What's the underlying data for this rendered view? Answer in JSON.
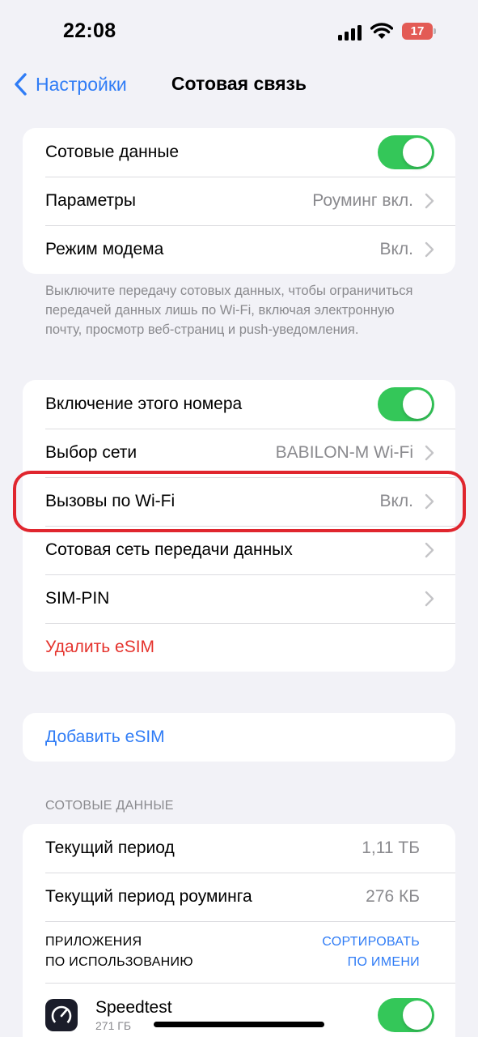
{
  "status_bar": {
    "time": "22:08",
    "battery_level": "17",
    "battery_color": "#e35b55"
  },
  "nav": {
    "back_label": "Настройки",
    "title": "Сотовая связь"
  },
  "group1": {
    "cellular_data_label": "Сотовые данные",
    "cellular_data_on": true,
    "options_label": "Параметры",
    "options_value": "Роуминг вкл.",
    "hotspot_label": "Режим модема",
    "hotspot_value": "Вкл."
  },
  "footnote": "Выключите передачу сотовых данных, чтобы ограничиться передачей данных лишь по Wi-Fi, включая электронную почту, просмотр веб-страниц и push-уведомления.",
  "group2": {
    "line_on_label": "Включение этого номера",
    "line_on": true,
    "network_label": "Выбор сети",
    "network_value": "BABILON-M Wi-Fi",
    "wifi_calls_label": "Вызовы по Wi-Fi",
    "wifi_calls_value": "Вкл.",
    "data_network_label": "Сотовая сеть передачи данных",
    "sim_pin_label": "SIM-PIN",
    "delete_esim_label": "Удалить eSIM"
  },
  "add_esim_label": "Добавить eSIM",
  "usage": {
    "section_header": "СОТОВЫЕ ДАННЫЕ",
    "current_period_label": "Текущий период",
    "current_period_value": "1,11 ТБ",
    "roaming_period_label": "Текущий период роуминга",
    "roaming_period_value": "276 КБ",
    "apps_header_line1": "ПРИЛОЖЕНИЯ",
    "apps_header_line2": "ПО ИСПОЛЬЗОВАНИЮ",
    "sort_line1": "СОРТИРОВАТЬ",
    "sort_line2": "ПО ИМЕНИ",
    "apps": [
      {
        "name": "Speedtest",
        "size": "271 ГБ",
        "icon": "speedtest-icon",
        "enabled": true
      }
    ]
  },
  "colors": {
    "accent": "#2f7cf6",
    "toggle_on": "#34c759",
    "destructive": "#e5332d",
    "highlight": "#e0262e"
  }
}
